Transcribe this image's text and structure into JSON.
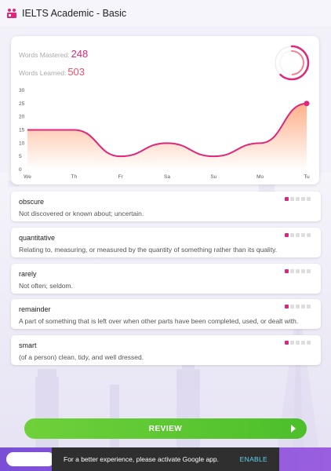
{
  "app": {
    "title": "IELTS Academic - Basic",
    "icon": "learner-icon"
  },
  "stats": {
    "mastered_label": "Words Mastered:",
    "mastered_value": "248",
    "learned_label": "Words Learned:",
    "learned_value": "503",
    "ring_fraction": 0.49,
    "colors": {
      "mastered": "#e0267a",
      "learned": "#f0506a"
    }
  },
  "chart_data": {
    "type": "area",
    "categories": [
      "We",
      "Th",
      "Fr",
      "Sa",
      "Su",
      "Mo",
      "Tu"
    ],
    "values": [
      15,
      15,
      5,
      10,
      5,
      10,
      25
    ],
    "ylim": [
      0,
      30
    ],
    "yticks": [
      0,
      5,
      10,
      15,
      20,
      25,
      30
    ],
    "grid": false,
    "line_color": "#e0267a",
    "fill_colors": [
      "#ffb08a",
      "#ffffff"
    ]
  },
  "words": [
    {
      "word": "obscure",
      "definition": "Not discovered or known about; uncertain.",
      "progress": 1,
      "max": 5
    },
    {
      "word": "quantitative",
      "definition": "Relating to, measuring, or measured by the quantity of something rather than its quality.",
      "progress": 1,
      "max": 5
    },
    {
      "word": "rarely",
      "definition": "Not often; seldom.",
      "progress": 1,
      "max": 5
    },
    {
      "word": "remainder",
      "definition": "A part of something that is left over when other parts have been completed, used, or dealt with.",
      "progress": 1,
      "max": 5
    },
    {
      "word": "smart",
      "definition": "(of a person) clean, tidy, and well dressed.",
      "progress": 1,
      "max": 5
    }
  ],
  "review": {
    "label": "REVIEW",
    "icon": "play-icon"
  },
  "snackbar": {
    "message": "For a better experience, please activate Google app.",
    "action": "ENABLE"
  }
}
